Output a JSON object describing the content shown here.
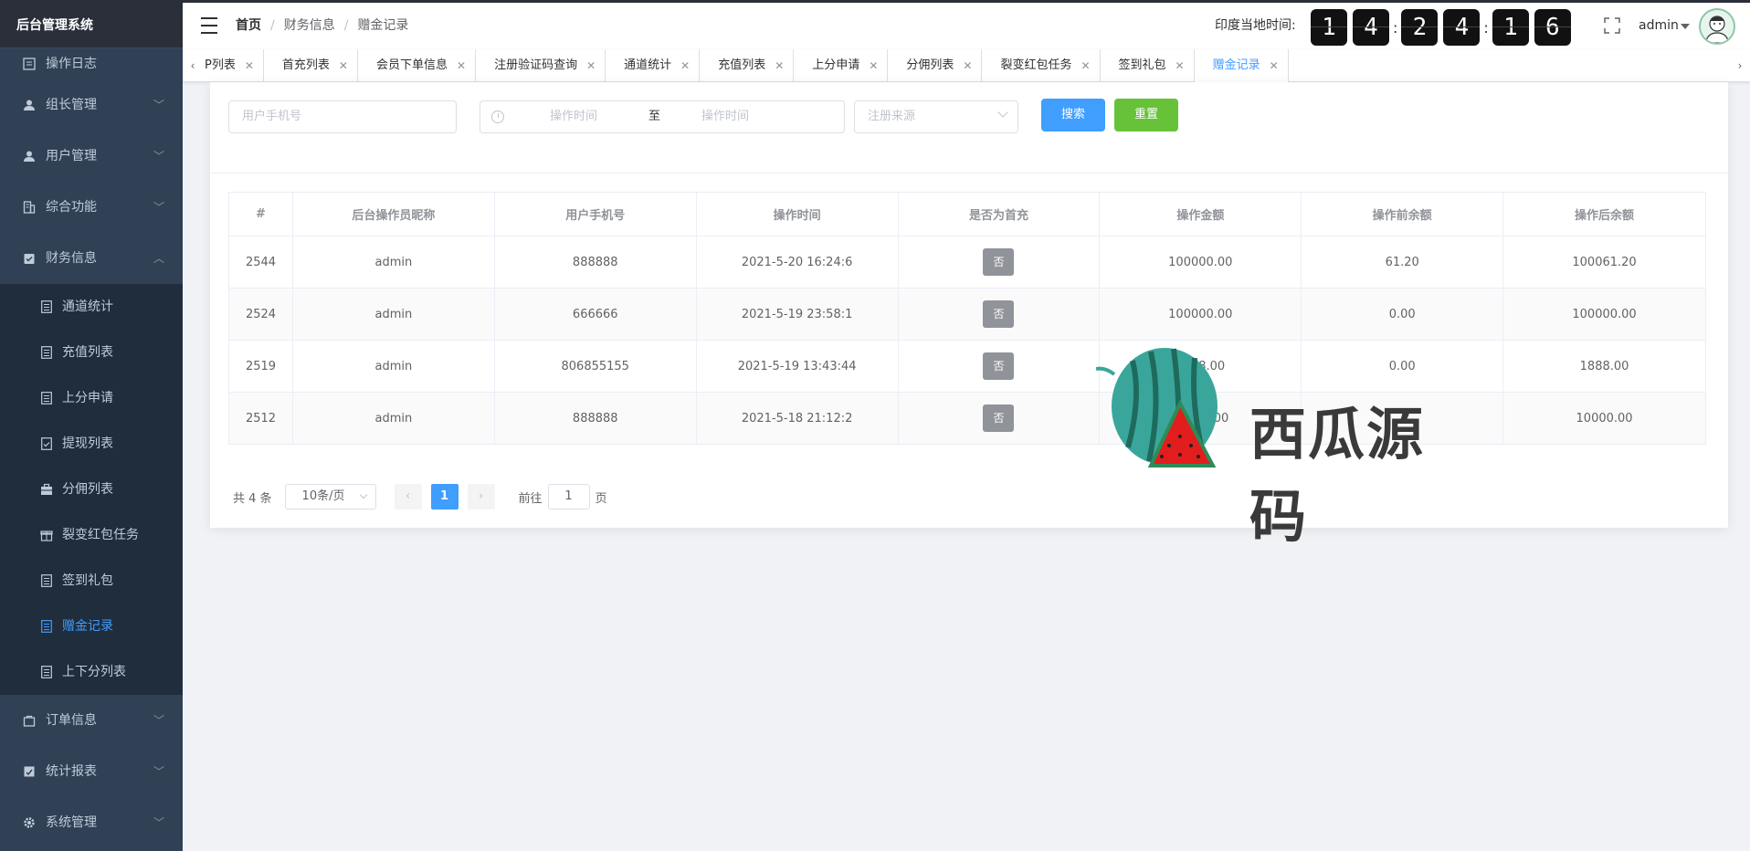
{
  "app": {
    "title": "后台管理系统"
  },
  "sidebar": {
    "items": [
      {
        "label": "操作日志",
        "icon": "log-icon"
      },
      {
        "label": "组长管理",
        "icon": "user-icon"
      },
      {
        "label": "用户管理",
        "icon": "user-icon"
      },
      {
        "label": "综合功能",
        "icon": "building-icon"
      },
      {
        "label": "财务信息",
        "icon": "clipboard-check-icon"
      },
      {
        "label": "订单信息",
        "icon": "bag-icon"
      },
      {
        "label": "统计报表",
        "icon": "chart-check-icon"
      },
      {
        "label": "系统管理",
        "icon": "gear-icon"
      }
    ],
    "finance_sub": [
      {
        "label": "通道统计"
      },
      {
        "label": "充值列表"
      },
      {
        "label": "上分申请"
      },
      {
        "label": "提现列表"
      },
      {
        "label": "分佣列表"
      },
      {
        "label": "裂变红包任务"
      },
      {
        "label": "签到礼包"
      },
      {
        "label": "赠金记录"
      },
      {
        "label": "上下分列表"
      }
    ],
    "active_color": "#409eff"
  },
  "header": {
    "breadcrumb": [
      "首页",
      "财务信息",
      "赠金记录"
    ],
    "clock_label": "印度当地时间:",
    "clock_digits": [
      "1",
      "4",
      "2",
      "4",
      "1",
      "6"
    ],
    "user_name": "admin"
  },
  "tabs": [
    {
      "label": "P列表"
    },
    {
      "label": "首充列表"
    },
    {
      "label": "会员下单信息"
    },
    {
      "label": "注册验证码查询"
    },
    {
      "label": "通道统计"
    },
    {
      "label": "充值列表"
    },
    {
      "label": "上分申请"
    },
    {
      "label": "分佣列表"
    },
    {
      "label": "裂变红包任务"
    },
    {
      "label": "签到礼包"
    },
    {
      "label": "赠金记录"
    }
  ],
  "filters": {
    "phone_placeholder": "用户手机号",
    "start_placeholder": "操作时间",
    "range_separator": "至",
    "end_placeholder": "操作时间",
    "source_placeholder": "注册来源",
    "search_label": "搜索",
    "reset_label": "重置"
  },
  "table": {
    "columns": [
      "#",
      "后台操作员昵称",
      "用户手机号",
      "操作时间",
      "是否为首充",
      "操作金额",
      "操作前余额",
      "操作后余额"
    ],
    "rows": [
      {
        "id": "2544",
        "operator": "admin",
        "phone": "888888",
        "time": "2021-5-20 16:24:6",
        "first": "否",
        "amount": "100000.00",
        "before": "61.20",
        "after": "100061.20"
      },
      {
        "id": "2524",
        "operator": "admin",
        "phone": "666666",
        "time": "2021-5-19 23:58:1",
        "first": "否",
        "amount": "100000.00",
        "before": "0.00",
        "after": "100000.00"
      },
      {
        "id": "2519",
        "operator": "admin",
        "phone": "806855155",
        "time": "2021-5-19 13:43:44",
        "first": "否",
        "amount": "1888.00",
        "before": "0.00",
        "after": "1888.00"
      },
      {
        "id": "2512",
        "operator": "admin",
        "phone": "888888",
        "time": "2021-5-18 21:12:2",
        "first": "否",
        "amount": "10000.00",
        "before": "",
        "after": "10000.00"
      }
    ]
  },
  "pagination": {
    "total": "共 4 条",
    "page_size": "10条/页",
    "current_page": "1",
    "goto_prefix": "前往",
    "goto_value": "1",
    "goto_suffix": "页"
  },
  "watermark": {
    "text": "西瓜源码"
  }
}
